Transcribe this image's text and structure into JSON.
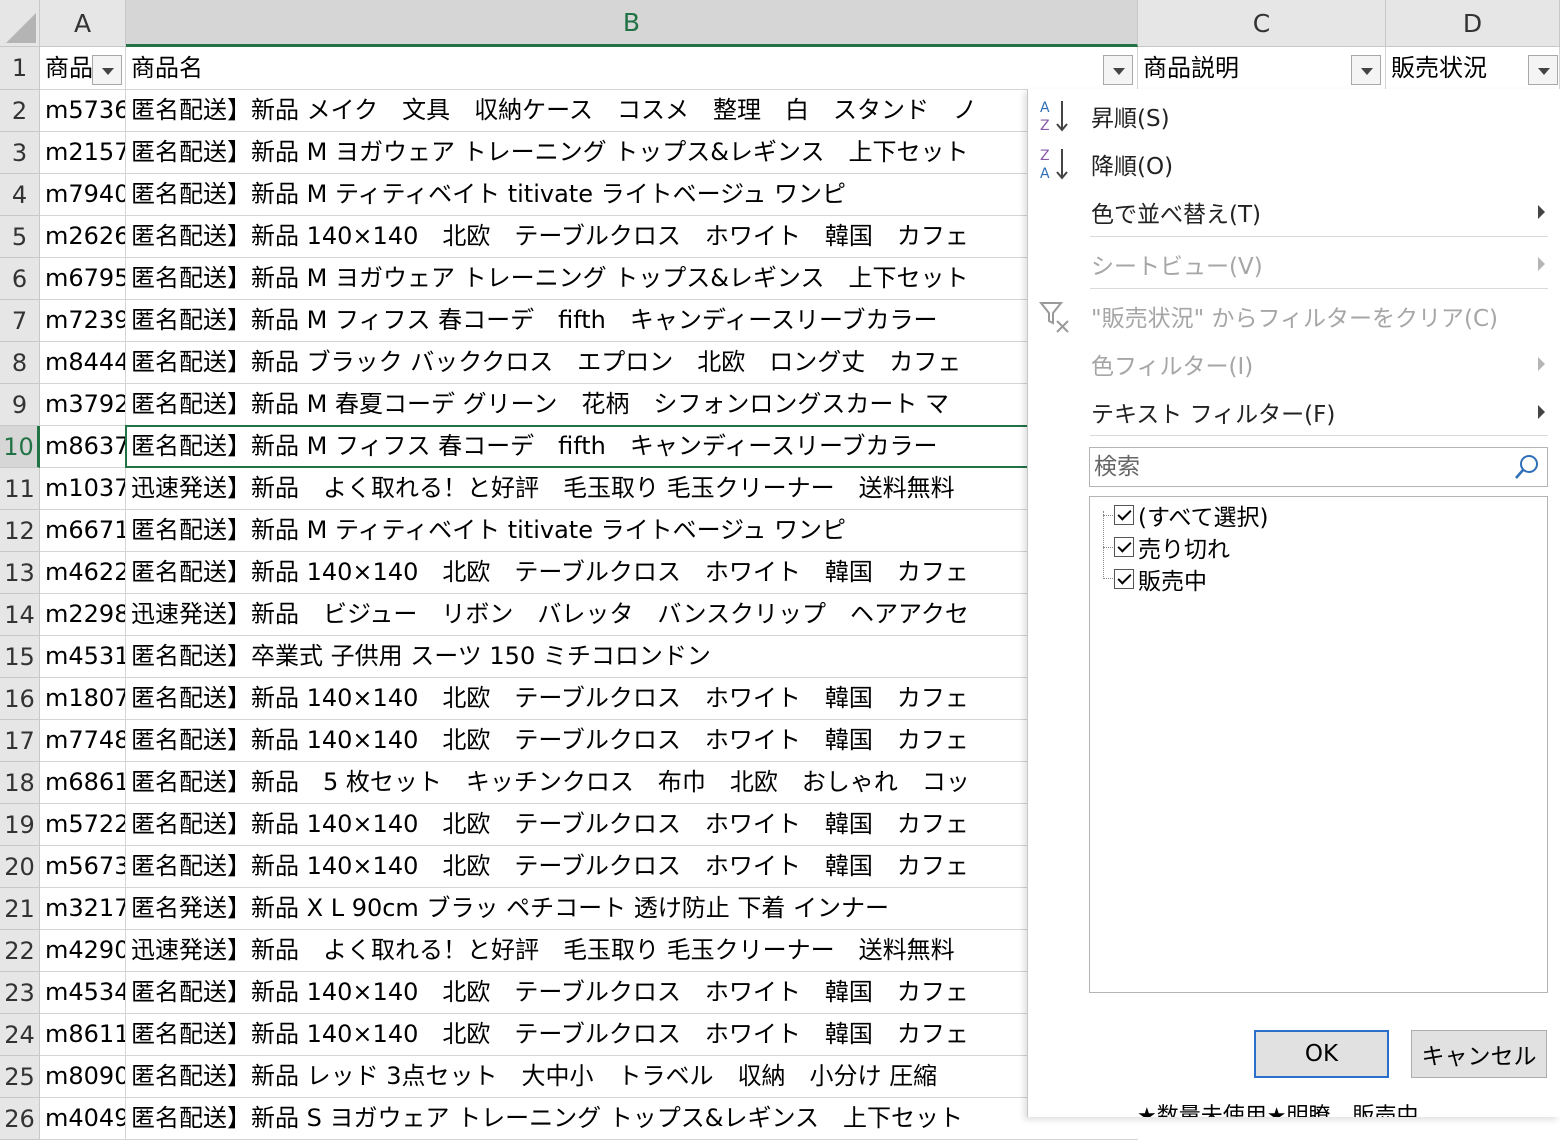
{
  "columns": [
    "A",
    "B",
    "C",
    "D"
  ],
  "header_row": {
    "num": "1",
    "cells": [
      "商品",
      "商品名",
      "商品説明",
      "販売状況"
    ]
  },
  "rows": [
    {
      "num": "2",
      "a": "m5736",
      "b": "匿名配送】新品 メイク　文具　収納ケース　コスメ　整理　白　スタンド　ノ"
    },
    {
      "num": "3",
      "a": "m2157",
      "b": "匿名配送】新品 M ヨガウェア トレーニング トップス&レギンス　上下セット"
    },
    {
      "num": "4",
      "a": "m7940",
      "b": "匿名配送】新品 M ティティベイト titivate ライトベージュ ワンピ"
    },
    {
      "num": "5",
      "a": "m2626",
      "b": "匿名配送】新品 140×140　北欧　テーブルクロス　ホワイト　韓国　カフェ"
    },
    {
      "num": "6",
      "a": "m6795",
      "b": "匿名配送】新品 M ヨガウェア トレーニング トップス&レギンス　上下セット"
    },
    {
      "num": "7",
      "a": "m7239",
      "b": "匿名配送】新品 M フィフス 春コーデ　fifth　キャンディースリーブカラー"
    },
    {
      "num": "8",
      "a": "m8444",
      "b": "匿名配送】新品 ブラック バッククロス　エプロン　北欧　ロング丈　カフェ"
    },
    {
      "num": "9",
      "a": "m3792",
      "b": "匿名配送】新品 M 春夏コーデ グリーン　花柄　シフォンロングスカート マ"
    },
    {
      "num": "10",
      "a": "m8637",
      "b": "匿名配送】新品 M フィフス 春コーデ　fifth　キャンディースリーブカラー"
    },
    {
      "num": "11",
      "a": "m1037",
      "b": "迅速発送】新品　よく取れる！と好評　毛玉取り 毛玉クリーナー　送料無料"
    },
    {
      "num": "12",
      "a": "m6671",
      "b": "匿名配送】新品 M ティティベイト titivate ライトベージュ ワンピ"
    },
    {
      "num": "13",
      "a": "m4622",
      "b": "匿名配送】新品 140×140　北欧　テーブルクロス　ホワイト　韓国　カフェ"
    },
    {
      "num": "14",
      "a": "m2298",
      "b": "迅速発送】新品　ビジュー　リボン　バレッタ　バンスクリップ　ヘアアクセ"
    },
    {
      "num": "15",
      "a": "m4531",
      "b": "匿名配送】卒業式 子供用 スーツ 150 ミチコロンドン"
    },
    {
      "num": "16",
      "a": "m1807",
      "b": "匿名配送】新品 140×140　北欧　テーブルクロス　ホワイト　韓国　カフェ"
    },
    {
      "num": "17",
      "a": "m7748",
      "b": "匿名配送】新品 140×140　北欧　テーブルクロス　ホワイト　韓国　カフェ"
    },
    {
      "num": "18",
      "a": "m6861",
      "b": "匿名配送】新品　5 枚セット　キッチンクロス　布巾　北欧　おしゃれ　コッ"
    },
    {
      "num": "19",
      "a": "m5722",
      "b": "匿名配送】新品 140×140　北欧　テーブルクロス　ホワイト　韓国　カフェ"
    },
    {
      "num": "20",
      "a": "m5673",
      "b": "匿名配送】新品 140×140　北欧　テーブルクロス　ホワイト　韓国　カフェ"
    },
    {
      "num": "21",
      "a": "m3217",
      "b": "匿名発送】新品 X L 90cm ブラッ ペチコート 透け防止 下着 インナー"
    },
    {
      "num": "22",
      "a": "m4290",
      "b": "迅速発送】新品　よく取れる！と好評　毛玉取り 毛玉クリーナー　送料無料"
    },
    {
      "num": "23",
      "a": "m4534",
      "b": "匿名配送】新品 140×140　北欧　テーブルクロス　ホワイト　韓国　カフェ"
    },
    {
      "num": "24",
      "a": "m8611",
      "b": "匿名配送】新品 140×140　北欧　テーブルクロス　ホワイト　韓国　カフェ"
    },
    {
      "num": "25",
      "a": "m8090",
      "b": "匿名配送】新品 レッド 3点セット　大中小　トラベル　収納　小分け 圧縮"
    },
    {
      "num": "26",
      "a": "m4049",
      "b": "匿名配送】新品 S ヨガウェア トレーニング トップス&レギンス　上下セット"
    }
  ],
  "partial_cd_row26": "★数量未使用★明瞭　販売中",
  "filter_menu": {
    "sort_asc": "昇順(S)",
    "sort_desc": "降順(O)",
    "sort_by_color": "色で並べ替え(T)",
    "sheet_view": "シートビュー(V)",
    "clear_filter": "\"販売状況\" からフィルターをクリア(C)",
    "color_filter": "色フィルター(I)",
    "text_filter": "テキスト フィルター(F)",
    "search_placeholder": "検索",
    "items": [
      "(すべて選択)",
      "売り切れ",
      "販売中"
    ],
    "items_checked": [
      true,
      true,
      true
    ],
    "ok": "OK",
    "cancel": "キャンセル"
  },
  "colors": {
    "accent_green": "#217346",
    "header_bg": "#e6e6e6",
    "disabled_text": "#a6a6a6",
    "button_focus": "#2a6fc9"
  }
}
